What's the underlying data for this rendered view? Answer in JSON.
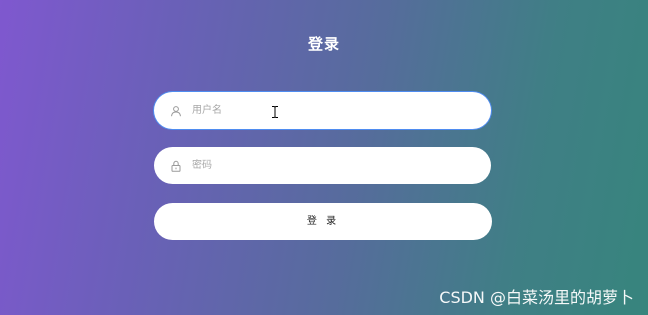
{
  "login": {
    "title": "登录",
    "username": {
      "placeholder": "用户名",
      "icon": "user-icon",
      "value": ""
    },
    "password": {
      "placeholder": "密码",
      "icon": "lock-icon",
      "value": ""
    },
    "submit_label": "登 录"
  },
  "watermark": "CSDN @白菜汤里的胡萝卜",
  "colors": {
    "gradient_start": "#7f58cf",
    "gradient_end": "#37857d",
    "focus_ring": "#4f8cf0",
    "field_bg": "#ffffff"
  }
}
